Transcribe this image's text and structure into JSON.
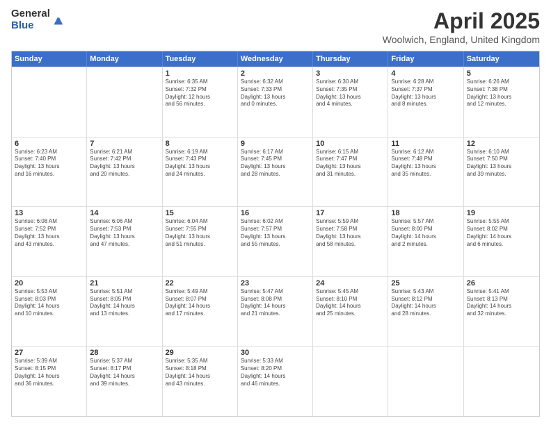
{
  "logo": {
    "general": "General",
    "blue": "Blue"
  },
  "title": "April 2025",
  "subtitle": "Woolwich, England, United Kingdom",
  "headers": [
    "Sunday",
    "Monday",
    "Tuesday",
    "Wednesday",
    "Thursday",
    "Friday",
    "Saturday"
  ],
  "rows": [
    [
      {
        "day": "",
        "info": ""
      },
      {
        "day": "",
        "info": ""
      },
      {
        "day": "1",
        "info": "Sunrise: 6:35 AM\nSunset: 7:32 PM\nDaylight: 12 hours\nand 56 minutes."
      },
      {
        "day": "2",
        "info": "Sunrise: 6:32 AM\nSunset: 7:33 PM\nDaylight: 13 hours\nand 0 minutes."
      },
      {
        "day": "3",
        "info": "Sunrise: 6:30 AM\nSunset: 7:35 PM\nDaylight: 13 hours\nand 4 minutes."
      },
      {
        "day": "4",
        "info": "Sunrise: 6:28 AM\nSunset: 7:37 PM\nDaylight: 13 hours\nand 8 minutes."
      },
      {
        "day": "5",
        "info": "Sunrise: 6:26 AM\nSunset: 7:38 PM\nDaylight: 13 hours\nand 12 minutes."
      }
    ],
    [
      {
        "day": "6",
        "info": "Sunrise: 6:23 AM\nSunset: 7:40 PM\nDaylight: 13 hours\nand 16 minutes."
      },
      {
        "day": "7",
        "info": "Sunrise: 6:21 AM\nSunset: 7:42 PM\nDaylight: 13 hours\nand 20 minutes."
      },
      {
        "day": "8",
        "info": "Sunrise: 6:19 AM\nSunset: 7:43 PM\nDaylight: 13 hours\nand 24 minutes."
      },
      {
        "day": "9",
        "info": "Sunrise: 6:17 AM\nSunset: 7:45 PM\nDaylight: 13 hours\nand 28 minutes."
      },
      {
        "day": "10",
        "info": "Sunrise: 6:15 AM\nSunset: 7:47 PM\nDaylight: 13 hours\nand 31 minutes."
      },
      {
        "day": "11",
        "info": "Sunrise: 6:12 AM\nSunset: 7:48 PM\nDaylight: 13 hours\nand 35 minutes."
      },
      {
        "day": "12",
        "info": "Sunrise: 6:10 AM\nSunset: 7:50 PM\nDaylight: 13 hours\nand 39 minutes."
      }
    ],
    [
      {
        "day": "13",
        "info": "Sunrise: 6:08 AM\nSunset: 7:52 PM\nDaylight: 13 hours\nand 43 minutes."
      },
      {
        "day": "14",
        "info": "Sunrise: 6:06 AM\nSunset: 7:53 PM\nDaylight: 13 hours\nand 47 minutes."
      },
      {
        "day": "15",
        "info": "Sunrise: 6:04 AM\nSunset: 7:55 PM\nDaylight: 13 hours\nand 51 minutes."
      },
      {
        "day": "16",
        "info": "Sunrise: 6:02 AM\nSunset: 7:57 PM\nDaylight: 13 hours\nand 55 minutes."
      },
      {
        "day": "17",
        "info": "Sunrise: 5:59 AM\nSunset: 7:58 PM\nDaylight: 13 hours\nand 58 minutes."
      },
      {
        "day": "18",
        "info": "Sunrise: 5:57 AM\nSunset: 8:00 PM\nDaylight: 14 hours\nand 2 minutes."
      },
      {
        "day": "19",
        "info": "Sunrise: 5:55 AM\nSunset: 8:02 PM\nDaylight: 14 hours\nand 6 minutes."
      }
    ],
    [
      {
        "day": "20",
        "info": "Sunrise: 5:53 AM\nSunset: 8:03 PM\nDaylight: 14 hours\nand 10 minutes."
      },
      {
        "day": "21",
        "info": "Sunrise: 5:51 AM\nSunset: 8:05 PM\nDaylight: 14 hours\nand 13 minutes."
      },
      {
        "day": "22",
        "info": "Sunrise: 5:49 AM\nSunset: 8:07 PM\nDaylight: 14 hours\nand 17 minutes."
      },
      {
        "day": "23",
        "info": "Sunrise: 5:47 AM\nSunset: 8:08 PM\nDaylight: 14 hours\nand 21 minutes."
      },
      {
        "day": "24",
        "info": "Sunrise: 5:45 AM\nSunset: 8:10 PM\nDaylight: 14 hours\nand 25 minutes."
      },
      {
        "day": "25",
        "info": "Sunrise: 5:43 AM\nSunset: 8:12 PM\nDaylight: 14 hours\nand 28 minutes."
      },
      {
        "day": "26",
        "info": "Sunrise: 5:41 AM\nSunset: 8:13 PM\nDaylight: 14 hours\nand 32 minutes."
      }
    ],
    [
      {
        "day": "27",
        "info": "Sunrise: 5:39 AM\nSunset: 8:15 PM\nDaylight: 14 hours\nand 36 minutes."
      },
      {
        "day": "28",
        "info": "Sunrise: 5:37 AM\nSunset: 8:17 PM\nDaylight: 14 hours\nand 39 minutes."
      },
      {
        "day": "29",
        "info": "Sunrise: 5:35 AM\nSunset: 8:18 PM\nDaylight: 14 hours\nand 43 minutes."
      },
      {
        "day": "30",
        "info": "Sunrise: 5:33 AM\nSunset: 8:20 PM\nDaylight: 14 hours\nand 46 minutes."
      },
      {
        "day": "",
        "info": ""
      },
      {
        "day": "",
        "info": ""
      },
      {
        "day": "",
        "info": ""
      }
    ]
  ]
}
